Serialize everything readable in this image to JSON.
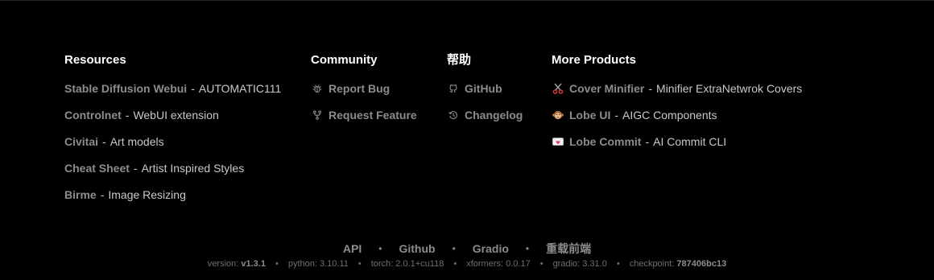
{
  "resources": {
    "title": "Resources",
    "items": [
      {
        "link": "Stable Diffusion Webui",
        "sep": "-",
        "desc": "AUTOMATIC111"
      },
      {
        "link": "Controlnet",
        "sep": "-",
        "desc": "WebUI extension"
      },
      {
        "link": "Civitai",
        "sep": "-",
        "desc": "Art models"
      },
      {
        "link": "Cheat Sheet",
        "sep": "-",
        "desc": "Artist Inspired Styles"
      },
      {
        "link": "Birme",
        "sep": "-",
        "desc": "Image Resizing"
      }
    ]
  },
  "community": {
    "title": "Community",
    "items": [
      {
        "icon": "bug-icon",
        "link": "Report Bug"
      },
      {
        "icon": "git-fork-icon",
        "link": "Request Feature"
      }
    ]
  },
  "help": {
    "title": "帮助",
    "items": [
      {
        "icon": "github-icon",
        "link": "GitHub"
      },
      {
        "icon": "history-icon",
        "link": "Changelog"
      }
    ]
  },
  "more_products": {
    "title": "More Products",
    "items": [
      {
        "icon": "scissors-emoji",
        "link": "Cover Minifier",
        "sep": "-",
        "desc": "Minifier ExtraNetwrok Covers"
      },
      {
        "icon": "monkey-face-emoji",
        "link": "Lobe UI",
        "sep": "-",
        "desc": "AIGC Components"
      },
      {
        "icon": "love-letter-emoji",
        "link": "Lobe Commit",
        "sep": "-",
        "desc": "AI Commit CLI"
      }
    ]
  },
  "bottom_links": [
    "API",
    "Github",
    "Gradio",
    "重载前端"
  ],
  "bottom_separator": "•",
  "versions": {
    "version_label": "version:",
    "version_value": "v1.3.1",
    "python": "python: 3.10.11",
    "torch": "torch: 2.0.1+cu118",
    "xformers": "xformers: 0.0.17",
    "gradio": "gradio: 3.31.0",
    "checkpoint_label": "checkpoint:",
    "checkpoint_value": "787406bc13"
  }
}
